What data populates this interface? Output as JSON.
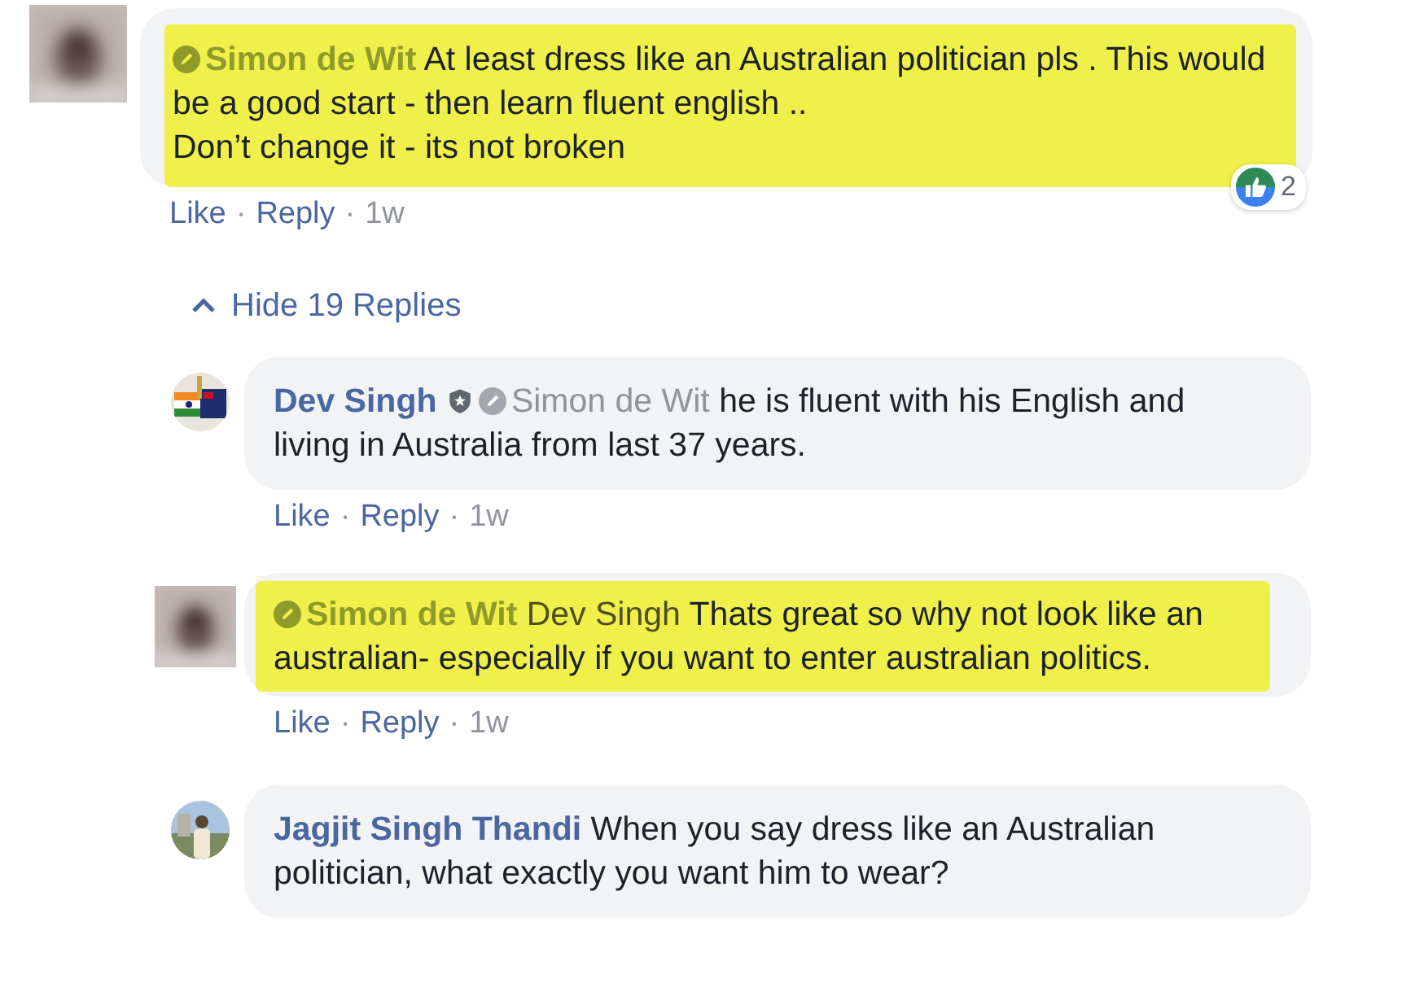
{
  "comment": {
    "author": "Simon de Wit",
    "verified": true,
    "shield_badge": false,
    "highlighted": true,
    "body": "At least dress like an Australian politician pls . This would be a good start - then learn fluent english ..\nDon’t change it - its not broken",
    "reactions": {
      "count": "2"
    },
    "actions": [
      {
        "kind": "link",
        "text": "Like"
      },
      {
        "kind": "dot",
        "text": "·"
      },
      {
        "kind": "link",
        "text": "Reply"
      },
      {
        "kind": "dot",
        "text": "·"
      },
      {
        "kind": "time",
        "text": "1w"
      }
    ]
  },
  "replies_toggle": {
    "label": "Hide 19 Replies",
    "expanded": true
  },
  "replies": [
    {
      "author": "Dev Singh",
      "verified": false,
      "shield_badge": true,
      "mention": {
        "name": "Simon de Wit",
        "verified": true
      },
      "highlighted": false,
      "body": "he is fluent with his English and living in Australia from last 37 years.",
      "actions": [
        {
          "kind": "link",
          "text": "Like"
        },
        {
          "kind": "dot",
          "text": "·"
        },
        {
          "kind": "link",
          "text": "Reply"
        },
        {
          "kind": "dot",
          "text": "·"
        },
        {
          "kind": "time",
          "text": "1w"
        }
      ]
    },
    {
      "author": "Simon de Wit",
      "verified": true,
      "shield_badge": false,
      "mention": {
        "name": "Dev Singh",
        "verified": false
      },
      "highlighted": true,
      "body": "Thats great so why not look like an australian- especially if you want to enter australian politics.",
      "actions": [
        {
          "kind": "link",
          "text": "Like"
        },
        {
          "kind": "dot",
          "text": "·"
        },
        {
          "kind": "link",
          "text": "Reply"
        },
        {
          "kind": "dot",
          "text": "·"
        },
        {
          "kind": "time",
          "text": "1w"
        }
      ]
    },
    {
      "author": "Jagjit Singh Thandi",
      "verified": false,
      "shield_badge": false,
      "highlighted": false,
      "body": "When you say dress like an Australian politician, what exactly you want him to wear?"
    }
  ]
}
